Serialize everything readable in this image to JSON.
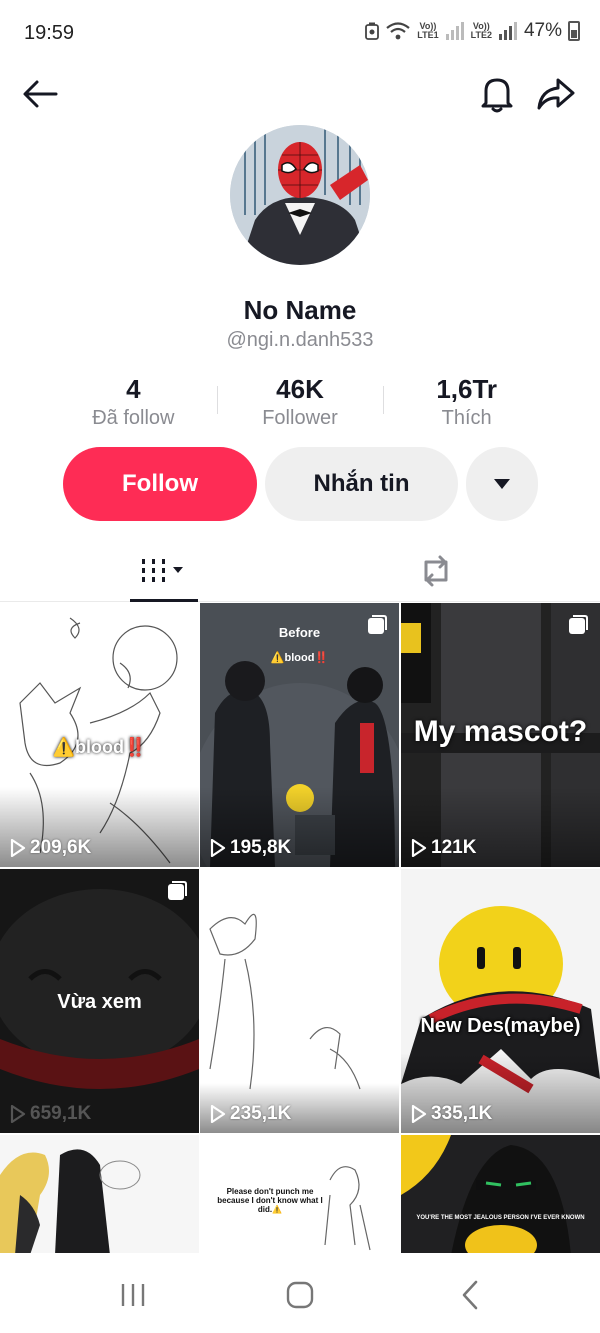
{
  "status_bar": {
    "time": "19:59",
    "net1_top": "Vo))",
    "net1_bottom": "LTE1",
    "net2_top": "Vo))",
    "net2_bottom": "LTE2",
    "battery": "47%"
  },
  "profile": {
    "display_name": "No Name",
    "username": "@ngi.n.danh533"
  },
  "stats": [
    {
      "value": "4",
      "label": "Đã follow"
    },
    {
      "value": "46K",
      "label": "Follower"
    },
    {
      "value": "1,6Tr",
      "label": "Thích"
    }
  ],
  "actions": {
    "follow_label": "Follow",
    "message_label": "Nhắn tin"
  },
  "colors": {
    "accent": "#fe2c55",
    "secondary_button": "#efefef",
    "muted_text": "#8a8b91"
  },
  "videos": [
    {
      "views": "209,6K",
      "overlay": "⚠️blood‼️"
    },
    {
      "views": "195,8K",
      "overlay_top": "Before",
      "overlay": "⚠️blood‼️"
    },
    {
      "views": "121K",
      "overlay": "My mascot?"
    },
    {
      "views": "659,1K",
      "overlay": "Vừa xem"
    },
    {
      "views": "235,1K",
      "overlay": ""
    },
    {
      "views": "335,1K",
      "overlay": "New Des(maybe)"
    },
    {
      "views": "",
      "overlay": ""
    },
    {
      "views": "",
      "overlay": "Please don't punch me because I don't know what I did.⚠️"
    },
    {
      "views": "",
      "overlay": "YOU'RE THE MOST JEALOUS PERSON I'VE EVER KNOWN"
    }
  ],
  "icons": {
    "back": "arrow-left-icon",
    "notifications": "bell-icon",
    "share": "share-arrow-icon",
    "more": "caret-down-icon",
    "videos_tab": "grid-bars-icon",
    "reposts_tab": "repost-icon"
  }
}
